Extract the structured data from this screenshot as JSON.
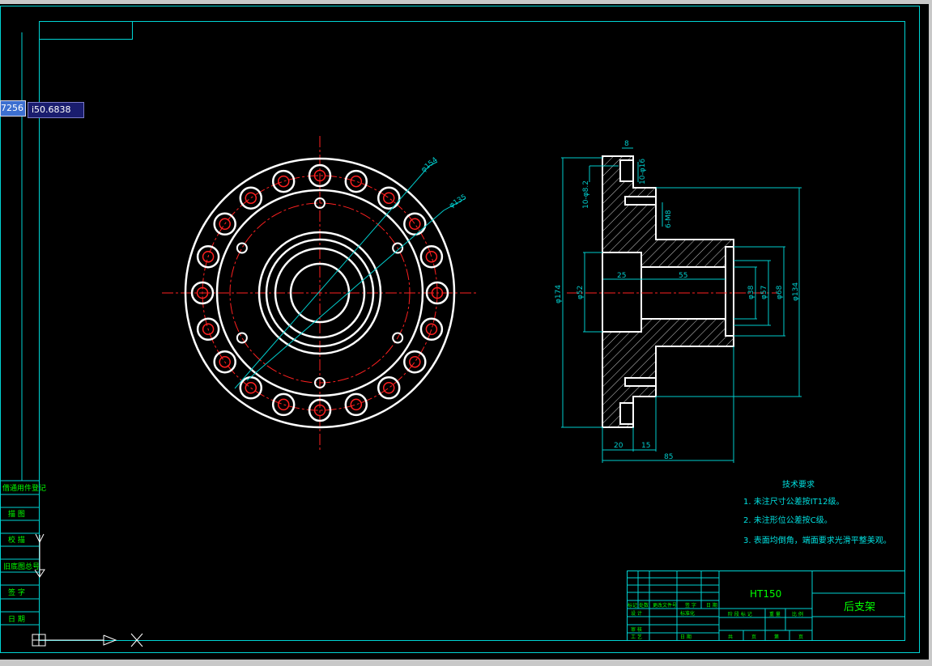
{
  "canvas": {
    "background": "#000000",
    "colors": {
      "frame": "#00d4d4",
      "part": "#ffffff",
      "center": "#ff2020",
      "dimension": "#00cccc",
      "text_cad": "#00ff00",
      "notes": "#00e0e0"
    }
  },
  "coord_input": {
    "left_value": "7256",
    "right_value": "i50.6838"
  },
  "left_margin_labels": [
    "借通用件登记",
    "描 图",
    "校 描",
    "旧底图总号",
    "签 字",
    "日 期"
  ],
  "front_view": {
    "dim_outer": "φ154",
    "dim_pitch": "φ135"
  },
  "section_view": {
    "dim_top_8": "8",
    "dim_10_phi16": "10-φ16",
    "dim_10_phi8_2": "10-φ8.2",
    "dim_6_m8": "6-M8",
    "dim_25": "25",
    "dim_55": "55",
    "dim_phi174": "φ174",
    "dim_phi52": "φ52",
    "dim_phi38": "φ38",
    "dim_phi57": "φ57",
    "dim_phi68": "φ68",
    "dim_phi134": "φ134",
    "dim_20": "20",
    "dim_15": "15",
    "dim_85": "85"
  },
  "technical_requirements": {
    "title": "技术要求",
    "items": [
      "1. 未注尺寸公差按IT12级。",
      "2. 未注形位公差按C级。",
      "3. 表面均倒角，端面要求光滑平整美观。"
    ]
  },
  "title_block": {
    "material": "HT150",
    "part_name": "后支架",
    "rev_headers": [
      "标记",
      "处数",
      "更改文件号",
      "签 字",
      "日 期"
    ],
    "row_labels": [
      "设 计",
      "标准化"
    ],
    "stage_headers": [
      "阶 段 标 记",
      "重 量",
      "比 例"
    ],
    "bottom_left": [
      "审 核",
      "工 艺"
    ],
    "bottom_mid": "日 期",
    "sheet_labels": [
      "共",
      "页",
      "第",
      "页"
    ]
  }
}
